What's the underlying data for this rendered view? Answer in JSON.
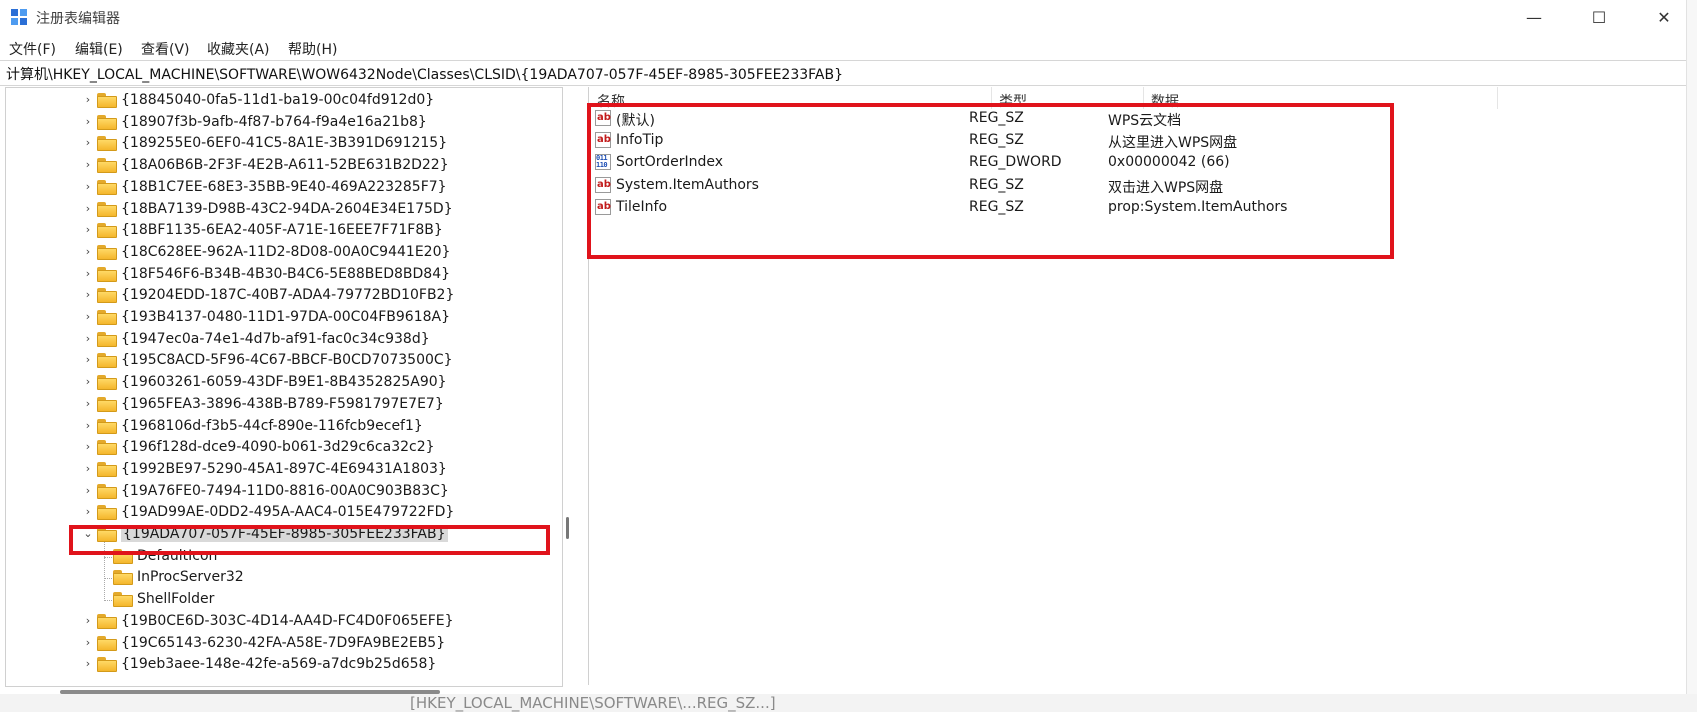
{
  "window": {
    "title": "注册表编辑器",
    "min_glyph": "—",
    "max_glyph": "☐",
    "close_glyph": "✕"
  },
  "menu": [
    {
      "label": "文件(F)"
    },
    {
      "label": "编辑(E)"
    },
    {
      "label": "查看(V)"
    },
    {
      "label": "收藏夹(A)"
    },
    {
      "label": "帮助(H)"
    }
  ],
  "address": "计算机\\HKEY_LOCAL_MACHINE\\SOFTWARE\\WOW6432Node\\Classes\\CLSID\\{19ADA707-057F-45EF-8985-305FEE233FAB}",
  "tree": {
    "items": [
      {
        "label": "{18845040-0fa5-11d1-ba19-00c04fd912d0}",
        "expander": "›"
      },
      {
        "label": "{18907f3b-9afb-4f87-b764-f9a4e16a21b8}",
        "expander": "›"
      },
      {
        "label": "{189255E0-6EF0-41C5-8A1E-3B391D691215}",
        "expander": "›"
      },
      {
        "label": "{18A06B6B-2F3F-4E2B-A611-52BE631B2D22}",
        "expander": "›"
      },
      {
        "label": "{18B1C7EE-68E3-35BB-9E40-469A223285F7}",
        "expander": "›"
      },
      {
        "label": "{18BA7139-D98B-43C2-94DA-2604E34E175D}",
        "expander": "›"
      },
      {
        "label": "{18BF1135-6EA2-405F-A71E-16EEE7F71F8B}",
        "expander": "›"
      },
      {
        "label": "{18C628EE-962A-11D2-8D08-00A0C9441E20}",
        "expander": "›"
      },
      {
        "label": "{18F546F6-B34B-4B30-B4C6-5E88BED8BD84}",
        "expander": "›"
      },
      {
        "label": "{19204EDD-187C-40B7-ADA4-79772BD10FB2}",
        "expander": "›"
      },
      {
        "label": "{193B4137-0480-11D1-97DA-00C04FB9618A}",
        "expander": "›"
      },
      {
        "label": "{1947ec0a-74e1-4d7b-af91-fac0c34c938d}",
        "expander": "›"
      },
      {
        "label": "{195C8ACD-5F96-4C67-BBCF-B0CD7073500C}",
        "expander": "›"
      },
      {
        "label": "{19603261-6059-43DF-B9E1-8B4352825A90}",
        "expander": "›"
      },
      {
        "label": "{1965FEA3-3896-438B-B789-F5981797E7E7}",
        "expander": "›"
      },
      {
        "label": "{1968106d-f3b5-44cf-890e-116fcb9ecef1}",
        "expander": "›"
      },
      {
        "label": "{196f128d-dce9-4090-b061-3d29c6ca32c2}",
        "expander": "›"
      },
      {
        "label": "{1992BE97-5290-45A1-897C-4E69431A1803}",
        "expander": "›"
      },
      {
        "label": "{19A76FE0-7494-11D0-8816-00A0C903B83C}",
        "expander": "›"
      },
      {
        "label": "{19AD99AE-0DD2-495A-AAC4-015E479722FD}",
        "expander": "›"
      },
      {
        "label": "{19ADA707-057F-45EF-8985-305FEE233FAB}",
        "expander": "⌄",
        "selected": true
      },
      {
        "label": "DefaultIcon",
        "child": true
      },
      {
        "label": "InProcServer32",
        "child": true
      },
      {
        "label": "ShellFolder",
        "child": true
      },
      {
        "label": "{19B0CE6D-303C-4D14-AA4D-FC4D0F065EFE}",
        "expander": "›"
      },
      {
        "label": "{19C65143-6230-42FA-A58E-7D9FA9BE2EB5}",
        "expander": "›"
      },
      {
        "label": "{19eb3aee-148e-42fe-a569-a7dc9b25d658}",
        "expander": "›"
      }
    ]
  },
  "values": {
    "headers": {
      "name": "名称",
      "type": "类型",
      "data": "数据"
    },
    "rows": [
      {
        "name": "(默认)",
        "type": "REG_SZ",
        "data": "WPS云文档",
        "icon": "ab"
      },
      {
        "name": "InfoTip",
        "type": "REG_SZ",
        "data": "从这里进入WPS网盘",
        "icon": "ab"
      },
      {
        "name": "SortOrderIndex",
        "type": "REG_DWORD",
        "data": "0x00000042 (66)",
        "icon": "011\n110"
      },
      {
        "name": "System.ItemAuthors",
        "type": "REG_SZ",
        "data": "双击进入WPS网盘",
        "icon": "ab"
      },
      {
        "name": "TileInfo",
        "type": "REG_SZ",
        "data": "prop:System.ItemAuthors",
        "icon": "ab"
      }
    ]
  },
  "background_text": "[HKEY_LOCAL_MACHINE\\SOFTWARE\\...REG_SZ...]",
  "colors": {
    "highlight": "#e0131b",
    "folder": "#f4b62c",
    "selection": "#d9d9d9"
  }
}
